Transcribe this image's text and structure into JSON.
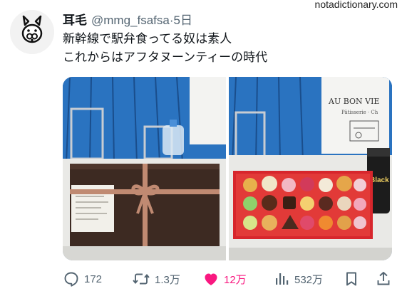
{
  "watermark": "notadictionary.com",
  "tweet": {
    "display_name": "耳毛",
    "handle": "@mmg_fsafsa",
    "separator": "·",
    "timestamp": "5日",
    "text_line1": "新幹線で駅弁食ってる奴は素人",
    "text_line2": "これからはアフタヌーンティーの時代"
  },
  "media": {
    "bag_text_left": "AU BON VIE",
    "bag_text_right": "AU BON VIE",
    "bag_subtext": "Pâtisserie · Ch",
    "can_text": "Black"
  },
  "actions": {
    "replies": "172",
    "reposts": "1.3万",
    "likes": "12万",
    "views": "532万"
  },
  "colors": {
    "like_active": "#f91880",
    "muted": "#536471",
    "text": "#0f1419"
  }
}
